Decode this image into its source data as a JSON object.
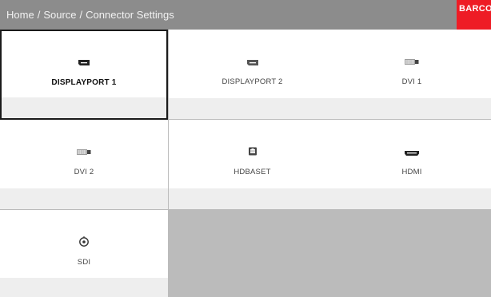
{
  "header": {
    "breadcrumb": [
      "Home",
      "Source",
      "Connector Settings"
    ],
    "separator": "/",
    "logo_text": "BARCO"
  },
  "tiles": [
    {
      "label": "DISPLAYPORT 1",
      "icon": "displayport-icon",
      "selected": true
    },
    {
      "label": "DISPLAYPORT 2",
      "icon": "displayport-icon",
      "selected": false
    },
    {
      "label": "DVI 1",
      "icon": "dvi-icon",
      "selected": false
    },
    {
      "label": "DVI 2",
      "icon": "dvi-icon",
      "selected": false
    },
    {
      "label": "HDBASET",
      "icon": "hdbaset-icon",
      "selected": false
    },
    {
      "label": "HDMI",
      "icon": "hdmi-icon",
      "selected": false
    },
    {
      "label": "SDI",
      "icon": "sdi-icon",
      "selected": false
    }
  ],
  "colors": {
    "header_bg": "#8c8c8c",
    "logo_bg": "#ee1c25",
    "tile_bg": "#ffffff",
    "tile_footer_bg": "#eeeeee",
    "empty_bg": "#bbbbbb",
    "selected_border": "#1a1a1a"
  }
}
